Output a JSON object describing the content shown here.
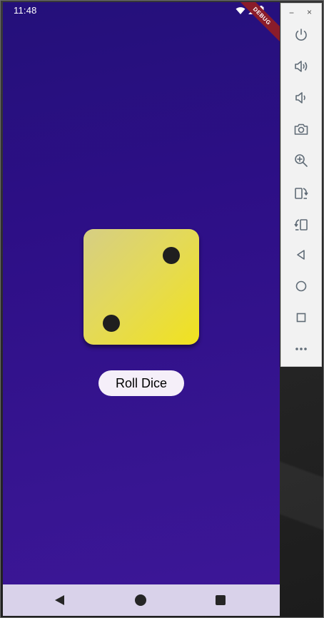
{
  "status_bar": {
    "time": "11:48",
    "debug_label": "DEBUG"
  },
  "dice": {
    "value": 2
  },
  "roll_button": {
    "label": "Roll Dice"
  },
  "colors": {
    "background_top": "#24107a",
    "background_bottom": "#3d1698",
    "dice_face": "#e3d95a",
    "pip": "#1f1f1f",
    "button_bg": "#f5eff9",
    "nav_bar": "#d9d2ea"
  },
  "emulator_toolbar": {
    "window_controls": [
      "minimize-icon",
      "close-icon"
    ],
    "buttons": [
      "power-icon",
      "volume-up-icon",
      "volume-down-icon",
      "camera-icon",
      "zoom-icon",
      "rotate-left-icon",
      "rotate-right-icon",
      "back-icon",
      "home-icon",
      "overview-icon",
      "more-icon"
    ],
    "minimize_glyph": "−",
    "close_glyph": "×"
  }
}
